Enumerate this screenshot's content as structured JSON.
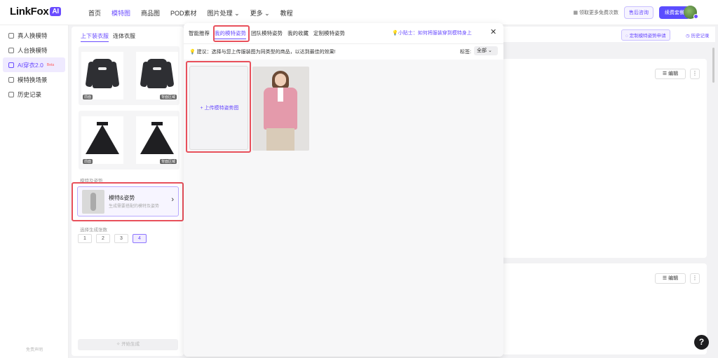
{
  "header": {
    "logo_text": "LinkFox",
    "logo_badge": "AI",
    "nav": [
      {
        "label": "首页"
      },
      {
        "label": "模特图"
      },
      {
        "label": "商品图"
      },
      {
        "label": "POD素材"
      },
      {
        "label": "图片处理 ⌄"
      },
      {
        "label": "更多 ⌄"
      },
      {
        "label": "教程"
      }
    ],
    "free_link": "领取更多免费次数",
    "after_sales": "售后咨询",
    "upgrade": "续费套餐"
  },
  "sidebar": {
    "items": [
      {
        "label": "真人换模特"
      },
      {
        "label": "人台换模特"
      },
      {
        "label": "AI穿衣2.0",
        "badge": "Beta"
      },
      {
        "label": "模特换场景"
      },
      {
        "label": "历史记录"
      }
    ],
    "footer": "免责声明"
  },
  "config": {
    "tabs": [
      "上下装衣服",
      "连体衣服"
    ],
    "top_tags": [
      "前面",
      "背面区域"
    ],
    "bottom_tags": [
      "前面",
      "背面区域"
    ],
    "model_section_label": "模特及姿势",
    "model_title": "模特&姿势",
    "model_sub": "生成需要搭配的模特及姿势",
    "count_label": "选择生成张数",
    "counts": [
      "1",
      "2",
      "3",
      "4"
    ],
    "generate_label": "开始生成"
  },
  "modal": {
    "tabs": [
      "智能推荐",
      "我的模特姿势",
      "团队模特姿势",
      "我的收藏",
      "定制模特姿势"
    ],
    "tip": "小贴士：如何将服装穿到模特身上",
    "suggest": "建议：选择与您上传服装图为同类型的商品，以达到最佳的效果!",
    "tag_label": "标签:",
    "tag_value": "全部 ⌄",
    "upload_label": "+ 上传模特姿势图"
  },
  "main": {
    "apply_label": "定制模特姿势申请",
    "history_label": "历史记录",
    "edit_label": "编辑",
    "more_label": "⋮",
    "help_label": "?"
  },
  "colors": {
    "accent": "#6a4cff",
    "highlight": "#e8505b"
  }
}
